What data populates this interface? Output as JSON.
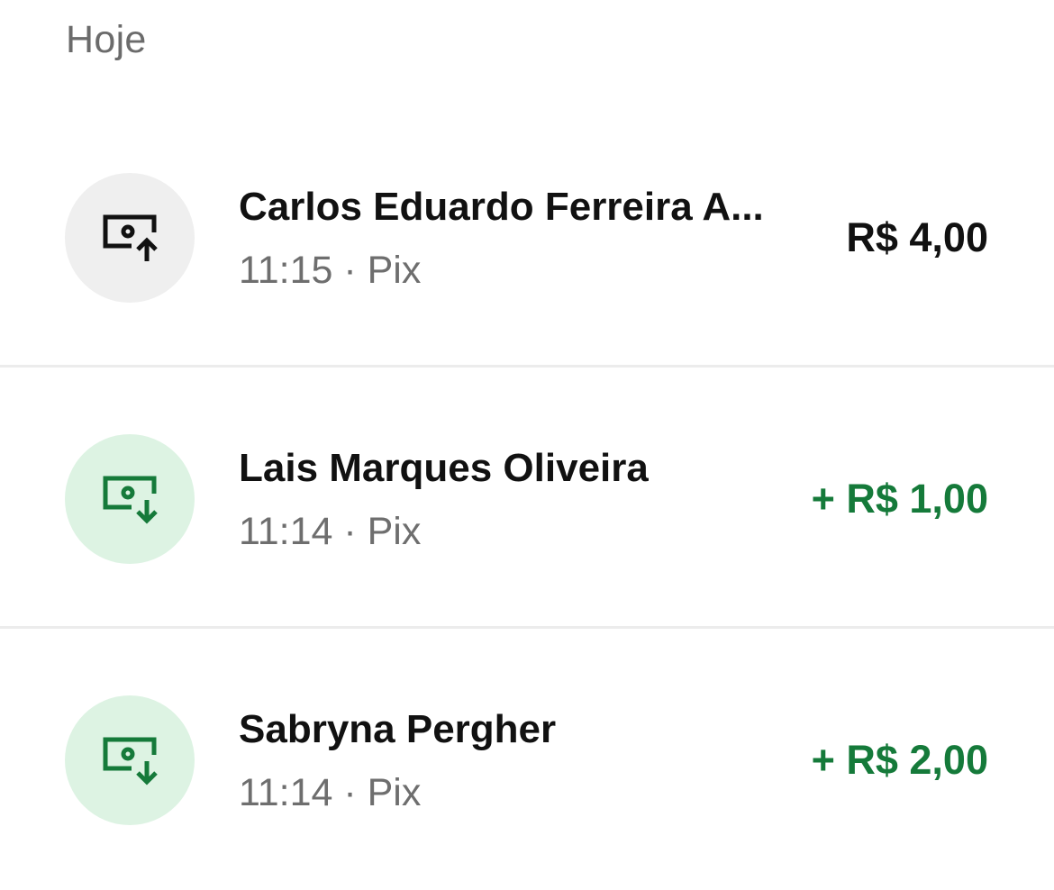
{
  "section": {
    "title": "Hoje"
  },
  "colors": {
    "incoming_amount": "#157a3a",
    "incoming_icon_bg": "#ddf3e3",
    "outgoing_icon_bg": "#efefef",
    "primary_text": "#111111",
    "secondary_text": "#6e6e6e"
  },
  "transactions": [
    {
      "name": "Carlos Eduardo Ferreira A...",
      "time": "11:15",
      "separator": "·",
      "method": "Pix",
      "meta": "11:15 · Pix",
      "amount": "R$ 4,00",
      "direction": "out",
      "icon": "money-send-icon"
    },
    {
      "name": "Lais Marques Oliveira",
      "time": "11:14",
      "separator": "·",
      "method": "Pix",
      "meta": "11:14 · Pix",
      "amount": "+ R$ 1,00",
      "direction": "in",
      "icon": "money-receive-icon"
    },
    {
      "name": "Sabryna Pergher",
      "time": "11:14",
      "separator": "·",
      "method": "Pix",
      "meta": "11:14 · Pix",
      "amount": "+ R$ 2,00",
      "direction": "in",
      "icon": "money-receive-icon"
    }
  ]
}
